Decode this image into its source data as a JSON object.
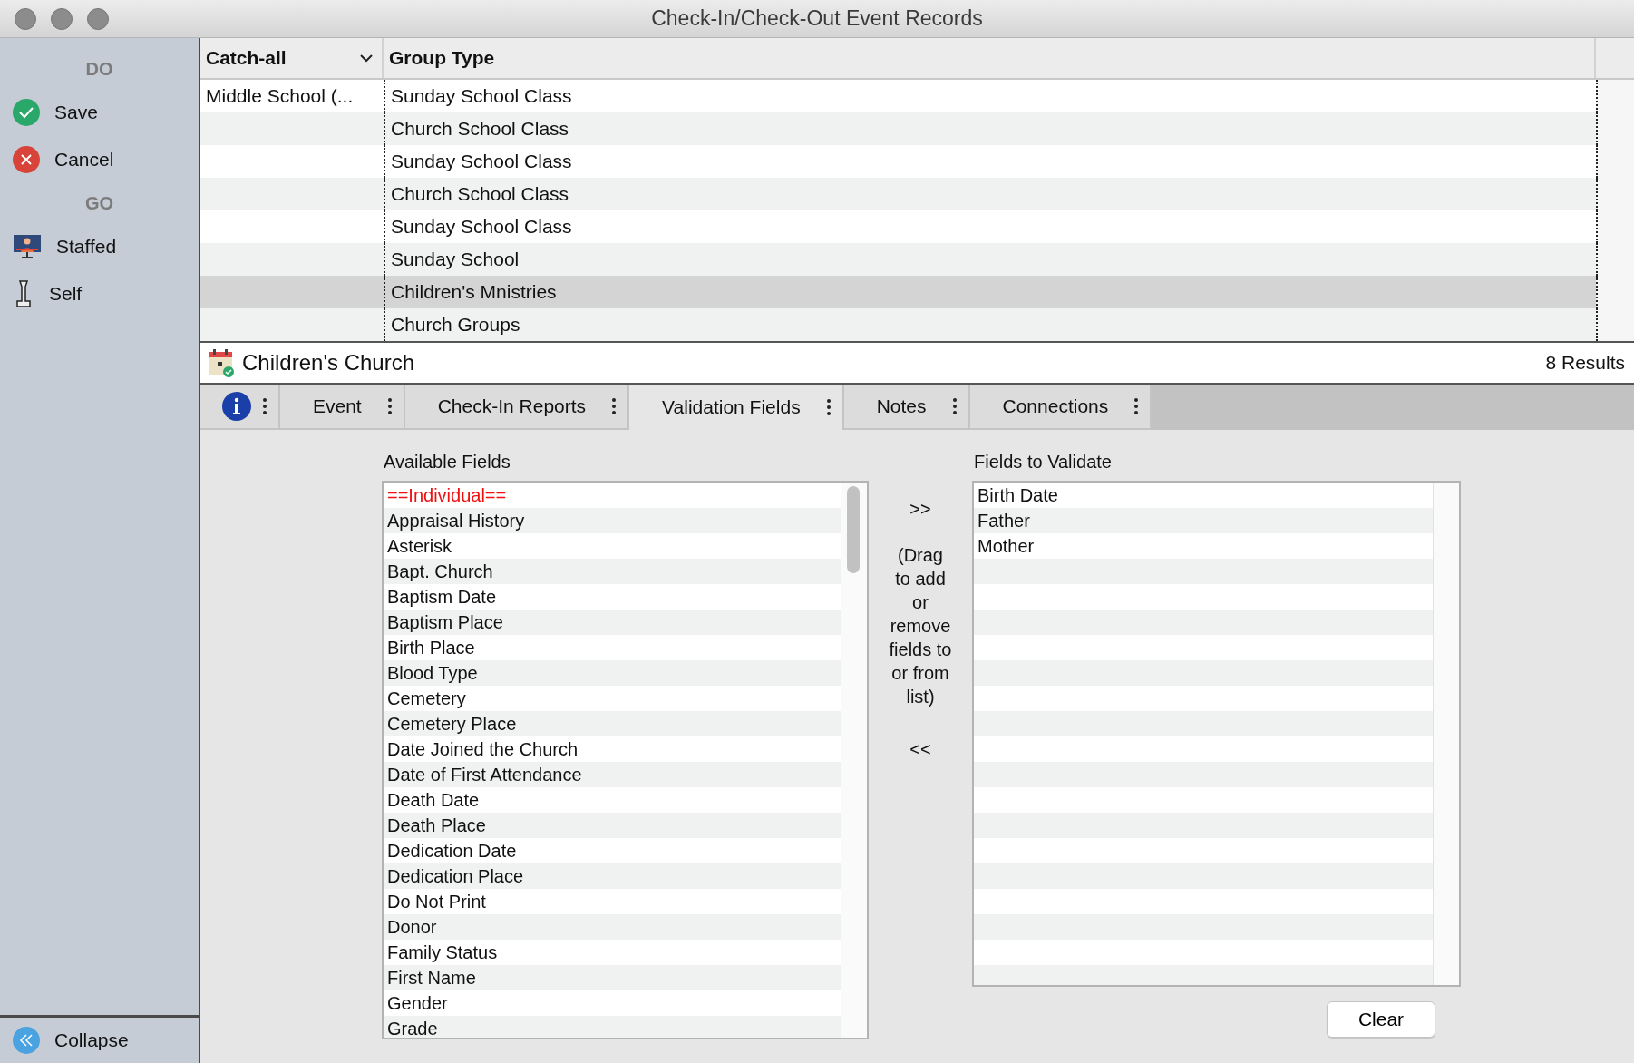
{
  "window": {
    "title": "Check-In/Check-Out Event Records"
  },
  "sidebar": {
    "sections": [
      {
        "heading": "DO",
        "items": [
          {
            "label": "Save"
          },
          {
            "label": "Cancel"
          }
        ]
      },
      {
        "heading": "GO",
        "items": [
          {
            "label": "Staffed"
          },
          {
            "label": "Self"
          }
        ]
      }
    ],
    "footer": {
      "label": "Collapse"
    }
  },
  "table": {
    "columns": [
      {
        "label": "Catch-all",
        "menu": true
      },
      {
        "label": "Group Type",
        "menu": false
      }
    ],
    "rows": [
      {
        "catch_all": "Middle School (...",
        "group_type": "Sunday School Class",
        "selected": false
      },
      {
        "group_type": "Church School Class",
        "selected": false
      },
      {
        "group_type": "Sunday School Class",
        "selected": false
      },
      {
        "group_type": "Church School Class",
        "selected": false
      },
      {
        "group_type": "Sunday School Class",
        "selected": false
      },
      {
        "group_type": "Sunday School",
        "selected": false
      },
      {
        "group_type": "Children's Mnistries",
        "selected": true
      },
      {
        "group_type": "Church Groups",
        "selected": false
      }
    ]
  },
  "record": {
    "title": "Children's Church",
    "results": "8 Results"
  },
  "tabs": [
    {
      "kind": "info",
      "selected": false
    },
    {
      "kind": "text",
      "label": "Event",
      "selected": false
    },
    {
      "kind": "text",
      "label": "Check-In Reports",
      "selected": false
    },
    {
      "kind": "text",
      "label": "Validation Fields",
      "selected": true
    },
    {
      "kind": "text",
      "label": "Notes",
      "selected": false
    },
    {
      "kind": "text",
      "label": "Connections",
      "selected": false
    }
  ],
  "validation": {
    "available": {
      "label": "Available Fields",
      "items": [
        {
          "text": "==Individual==",
          "kind": "heading"
        },
        {
          "text": "Appraisal History",
          "kind": "field"
        },
        {
          "text": "Asterisk",
          "kind": "field"
        },
        {
          "text": "Bapt. Church",
          "kind": "field"
        },
        {
          "text": "Baptism Date",
          "kind": "field"
        },
        {
          "text": "Baptism Place",
          "kind": "field"
        },
        {
          "text": "Birth Place",
          "kind": "field"
        },
        {
          "text": "Blood Type",
          "kind": "field"
        },
        {
          "text": "Cemetery",
          "kind": "field"
        },
        {
          "text": "Cemetery Place",
          "kind": "field"
        },
        {
          "text": "Date Joined the Church",
          "kind": "field"
        },
        {
          "text": "Date of First Attendance",
          "kind": "field"
        },
        {
          "text": "Death Date",
          "kind": "field"
        },
        {
          "text": "Death Place",
          "kind": "field"
        },
        {
          "text": "Dedication Date",
          "kind": "field"
        },
        {
          "text": "Dedication Place",
          "kind": "field"
        },
        {
          "text": "Do Not Print",
          "kind": "field"
        },
        {
          "text": "Donor",
          "kind": "field"
        },
        {
          "text": "Family Status",
          "kind": "field"
        },
        {
          "text": "First Name",
          "kind": "field"
        },
        {
          "text": "Gender",
          "kind": "field"
        },
        {
          "text": "Grade",
          "kind": "field"
        }
      ]
    },
    "transfer": {
      "add": ">>",
      "hint": "(Drag to add or remove fields to or from list)",
      "remove": "<<"
    },
    "selected": {
      "label": "Fields to Validate",
      "items": [
        {
          "text": "Birth Date"
        },
        {
          "text": "Father"
        },
        {
          "text": "Mother"
        }
      ]
    },
    "clear_button": "Clear"
  }
}
